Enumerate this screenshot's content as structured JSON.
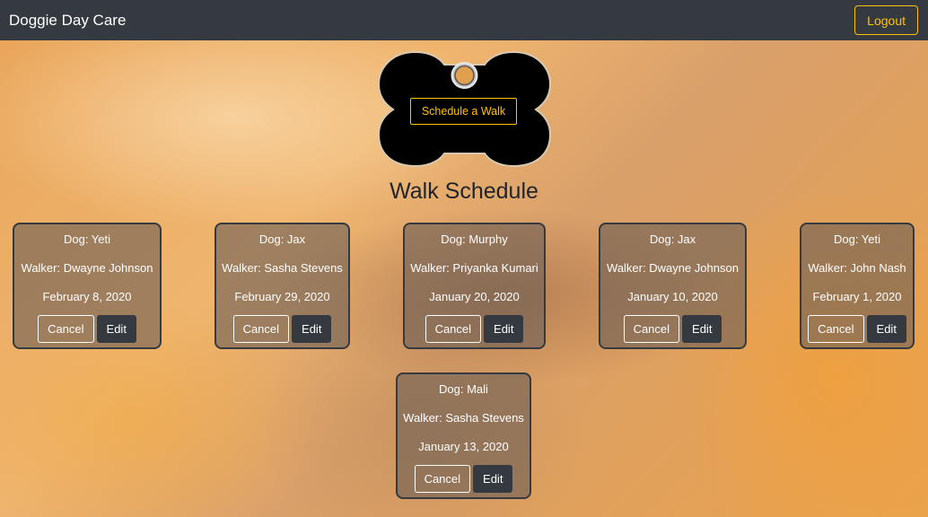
{
  "navbar": {
    "brand": "Doggie Day Care",
    "logout_label": "Logout"
  },
  "hero": {
    "schedule_label": "Schedule a Walk"
  },
  "page_title": "Walk Schedule",
  "walks": [
    {
      "dog": "Dog: Yeti",
      "walker": "Walker: Dwayne Johnson",
      "date": "February 8, 2020",
      "cancel": "Cancel",
      "edit": "Edit"
    },
    {
      "dog": "Dog: Jax",
      "walker": "Walker: Sasha Stevens",
      "date": "February 29, 2020",
      "cancel": "Cancel",
      "edit": "Edit"
    },
    {
      "dog": "Dog: Murphy",
      "walker": "Walker: Priyanka Kumari",
      "date": "January 20, 2020",
      "cancel": "Cancel",
      "edit": "Edit"
    },
    {
      "dog": "Dog: Jax",
      "walker": "Walker: Dwayne Johnson",
      "date": "January 10, 2020",
      "cancel": "Cancel",
      "edit": "Edit"
    },
    {
      "dog": "Dog: Yeti",
      "walker": "Walker: John Nash",
      "date": "February 1, 2020",
      "cancel": "Cancel",
      "edit": "Edit"
    },
    {
      "dog": "Dog: Mali",
      "walker": "Walker: Sasha Stevens",
      "date": "January 13, 2020",
      "cancel": "Cancel",
      "edit": "Edit"
    }
  ],
  "colors": {
    "navbar": "#343a40",
    "accent": "#ffc107",
    "card_border": "#343a40"
  }
}
